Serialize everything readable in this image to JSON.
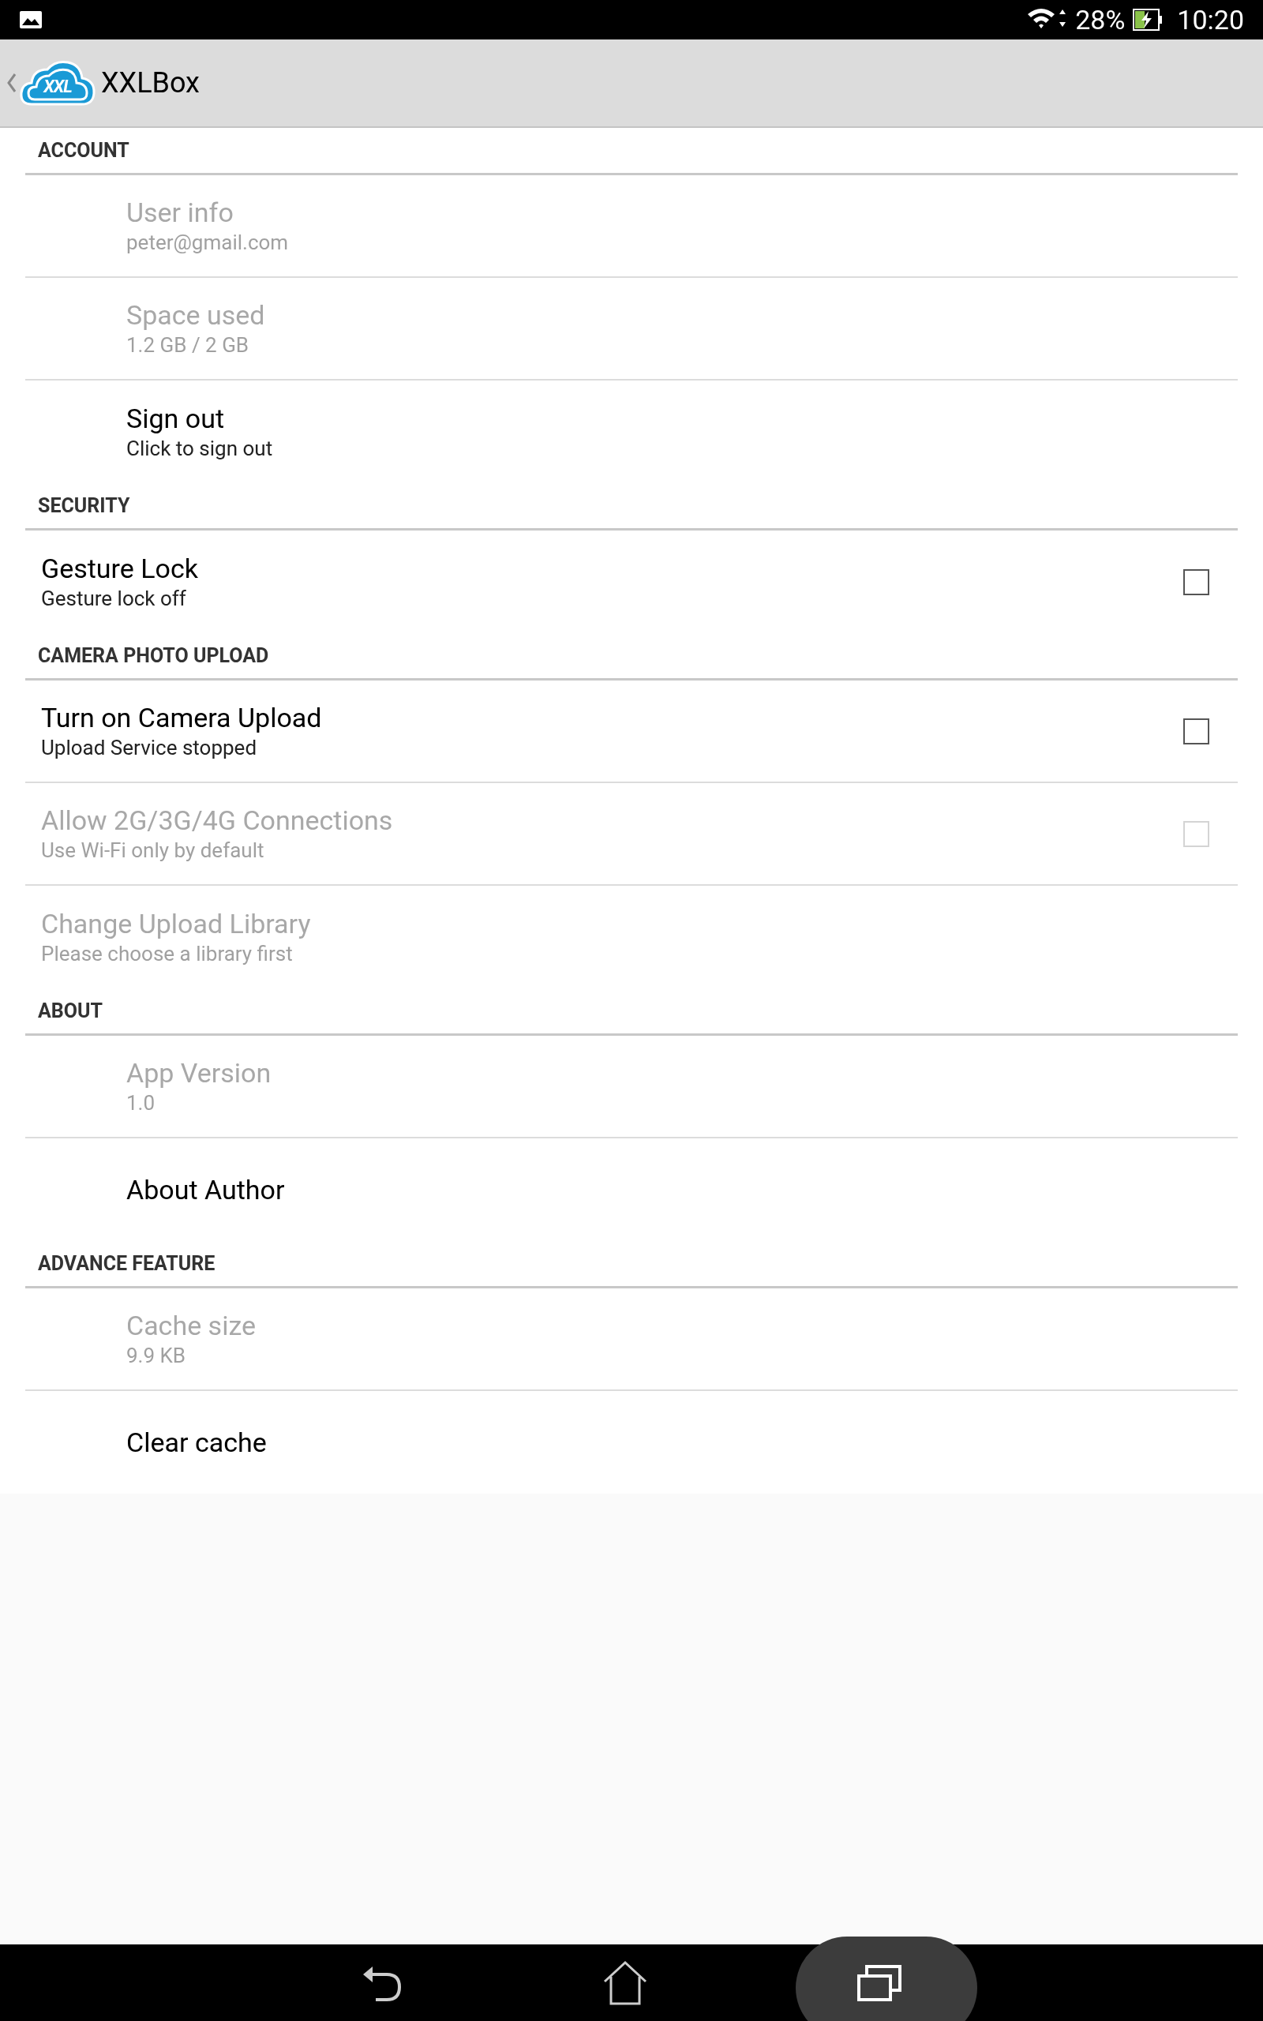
{
  "status_bar": {
    "battery": "28%",
    "time": "10:20"
  },
  "app_bar": {
    "logo_text": "XXL",
    "title": "XXLBox"
  },
  "sections": [
    {
      "title": "ACCOUNT",
      "items": [
        {
          "kind": "indented",
          "title": "User info",
          "subtitle": "peter@gmail.com",
          "disabled": true
        },
        {
          "kind": "indented",
          "title": "Space used",
          "subtitle": "1.2 GB / 2 GB",
          "disabled": true
        },
        {
          "kind": "indented",
          "title": "Sign out",
          "subtitle": "Click to sign out",
          "disabled": false
        }
      ]
    },
    {
      "title": "SECURITY",
      "items": [
        {
          "kind": "checkbox",
          "title": "Gesture Lock",
          "subtitle": "Gesture lock off",
          "disabled": false,
          "checked": false
        }
      ]
    },
    {
      "title": "CAMERA PHOTO UPLOAD",
      "items": [
        {
          "kind": "checkbox",
          "title": "Turn on Camera Upload",
          "subtitle": "Upload Service stopped",
          "disabled": false,
          "checked": false
        },
        {
          "kind": "checkbox",
          "title": "Allow 2G/3G/4G Connections",
          "subtitle": "Use Wi-Fi only by default",
          "disabled": true,
          "checked": false
        },
        {
          "kind": "plain",
          "title": "Change Upload Library",
          "subtitle": "Please choose a library first",
          "disabled": true
        }
      ]
    },
    {
      "title": "ABOUT",
      "items": [
        {
          "kind": "indented",
          "title": "App Version",
          "subtitle": "1.0",
          "disabled": true
        },
        {
          "kind": "indented",
          "title": "About Author",
          "disabled": false
        }
      ]
    },
    {
      "title": "ADVANCE FEATURE",
      "items": [
        {
          "kind": "indented",
          "title": "Cache size",
          "subtitle": "9.9 KB",
          "disabled": true
        },
        {
          "kind": "indented",
          "title": "Clear cache",
          "disabled": false
        }
      ]
    }
  ]
}
